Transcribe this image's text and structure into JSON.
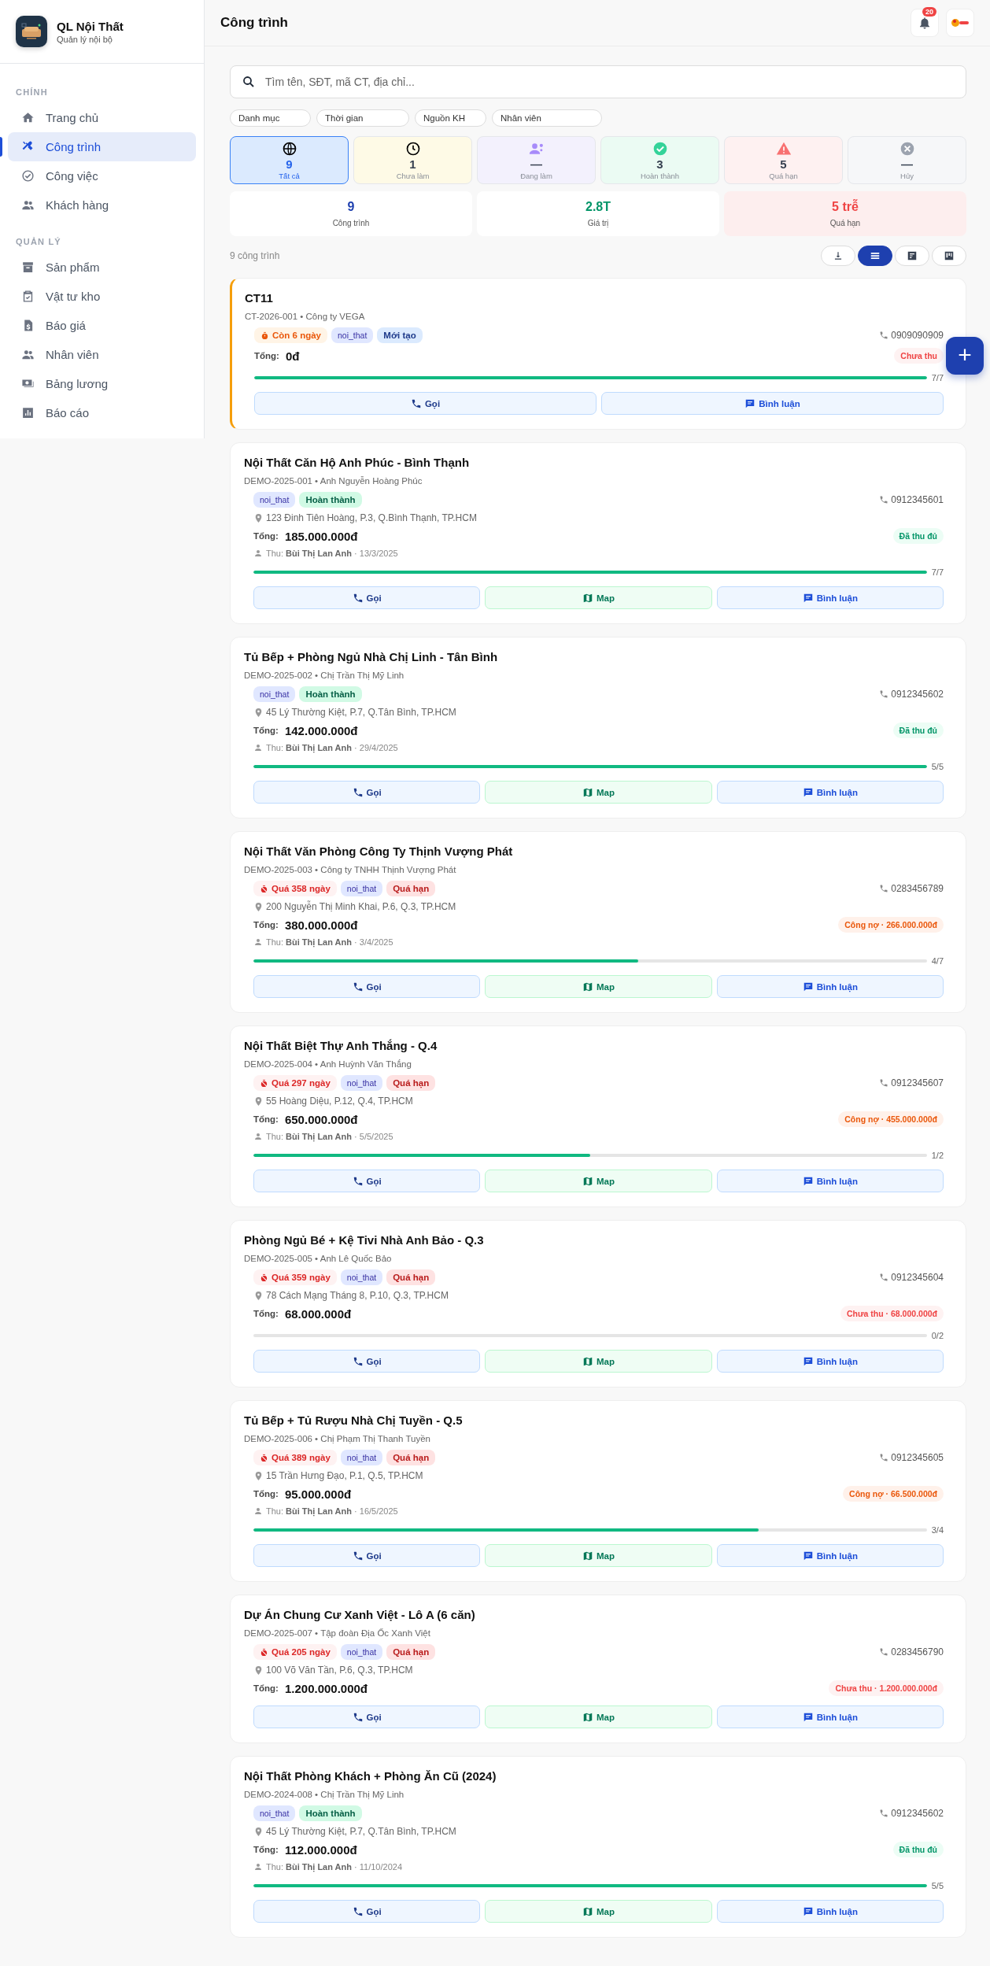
{
  "sidebar": {
    "app_name": "QL Nội Thất",
    "app_subtitle": "Quản lý nội bộ",
    "sections": [
      {
        "title": "CHÍNH",
        "items": [
          {
            "label": "Trang chủ",
            "selected": false
          },
          {
            "label": "Công trình",
            "selected": true
          },
          {
            "label": "Công việc",
            "selected": false
          },
          {
            "label": "Khách hàng",
            "selected": false
          }
        ]
      },
      {
        "title": "QUẢN LÝ",
        "items": [
          {
            "label": "Sản phẩm",
            "selected": false
          },
          {
            "label": "Vật tư kho",
            "selected": false
          },
          {
            "label": "Báo giá",
            "selected": false
          },
          {
            "label": "Nhân viên",
            "selected": false
          },
          {
            "label": "Bảng lương",
            "selected": false
          },
          {
            "label": "Báo cáo",
            "selected": false
          }
        ]
      }
    ]
  },
  "header": {
    "title": "Công trình",
    "notification_count": "20"
  },
  "search": {
    "placeholder": "Tìm tên, SĐT, mã CT, địa chỉ..."
  },
  "filters": [
    "Danh mục",
    "Thời gian",
    "Nguồn KH",
    "Nhân viên"
  ],
  "status_tiles": [
    {
      "kind": "all",
      "count": "9",
      "label": "Tất cả",
      "selected": true
    },
    {
      "kind": "pending",
      "count": "1",
      "label": "Chưa làm",
      "selected": false
    },
    {
      "kind": "active",
      "count": "—",
      "label": "Đang làm",
      "selected": false
    },
    {
      "kind": "done",
      "count": "3",
      "label": "Hoàn thành",
      "selected": false
    },
    {
      "kind": "overdue",
      "count": "5",
      "label": "Quá hạn",
      "selected": false
    },
    {
      "kind": "cancelled",
      "count": "—",
      "label": "Hủy",
      "selected": false
    }
  ],
  "summary": [
    {
      "kind": "count",
      "value": "9",
      "label": "Công trình"
    },
    {
      "kind": "value",
      "value": "2.8T",
      "label": "Giá trị"
    },
    {
      "kind": "late",
      "value": "5 trễ",
      "label": "Quá hạn"
    }
  ],
  "result_count": "9 công trình",
  "view_buttons": [
    {
      "kind": "download",
      "selected": false
    },
    {
      "kind": "list",
      "selected": true
    },
    {
      "kind": "chart",
      "selected": false
    },
    {
      "kind": "board",
      "selected": false
    }
  ],
  "cards": [
    {
      "title": "CT11",
      "meta": "CT-2026-001 • Công ty VEGA",
      "highlighted": true,
      "tags": [
        {
          "kind": "soon",
          "text": "Còn 6 ngày"
        },
        {
          "kind": "category",
          "text": "noi_that"
        },
        {
          "kind": "new",
          "text": "Mới tạo"
        }
      ],
      "phone": "0909090909",
      "total_label": "Tổng:",
      "total": "0đ",
      "payment": {
        "kind": "unpaid",
        "text": "Chưa thu"
      },
      "progress": {
        "level": 1,
        "text": "7/7"
      },
      "buttons": [
        {
          "kind": "call",
          "label": "Gọi"
        },
        {
          "kind": "comment",
          "label": "Bình luận"
        }
      ]
    },
    {
      "title": "Nội Thất Căn Hộ Anh Phúc - Bình Thạnh",
      "meta": "DEMO-2025-001 • Anh Nguyễn Hoàng Phúc",
      "highlighted": false,
      "tags": [
        {
          "kind": "category",
          "text": "noi_that"
        },
        {
          "kind": "done",
          "text": "Hoàn thành"
        }
      ],
      "phone": "0912345601",
      "address": "123 Đinh Tiên Hoàng, P.3, Q.Bình Thạnh, TP.HCM",
      "total_label": "Tổng:",
      "total": "185.000.000đ",
      "payment": {
        "kind": "paid",
        "text": "Đã thu đủ"
      },
      "collector": {
        "label": "Thu:",
        "name": "Bùi Thị Lan Anh",
        "date": "· 13/3/2025"
      },
      "progress": {
        "level": 1,
        "text": "7/7"
      },
      "buttons": [
        {
          "kind": "call",
          "label": "Gọi"
        },
        {
          "kind": "map",
          "label": "Map"
        },
        {
          "kind": "comment",
          "label": "Bình luận"
        }
      ]
    },
    {
      "title": "Tủ Bếp + Phòng Ngủ Nhà Chị Linh - Tân Bình",
      "meta": "DEMO-2025-002 • Chị Trần Thị Mỹ Linh",
      "highlighted": false,
      "tags": [
        {
          "kind": "category",
          "text": "noi_that"
        },
        {
          "kind": "done",
          "text": "Hoàn thành"
        }
      ],
      "phone": "0912345602",
      "address": "45 Lý Thường Kiệt, P.7, Q.Tân Bình, TP.HCM",
      "total_label": "Tổng:",
      "total": "142.000.000đ",
      "payment": {
        "kind": "paid",
        "text": "Đã thu đủ"
      },
      "collector": {
        "label": "Thu:",
        "name": "Bùi Thị Lan Anh",
        "date": "· 29/4/2025"
      },
      "progress": {
        "level": 1,
        "text": "5/5"
      },
      "buttons": [
        {
          "kind": "call",
          "label": "Gọi"
        },
        {
          "kind": "map",
          "label": "Map"
        },
        {
          "kind": "comment",
          "label": "Bình luận"
        }
      ]
    },
    {
      "title": "Nội Thất Văn Phòng Công Ty Thịnh Vượng Phát",
      "meta": "DEMO-2025-003 • Công ty TNHH Thịnh Vượng Phát",
      "highlighted": false,
      "tags": [
        {
          "kind": "late",
          "text": "Quá 358 ngày"
        },
        {
          "kind": "category",
          "text": "noi_that"
        },
        {
          "kind": "overdue",
          "text": "Quá hạn"
        }
      ],
      "phone": "0283456789",
      "address": "200 Nguyễn Thị Minh Khai, P.6, Q.3, TP.HCM",
      "total_label": "Tổng:",
      "total": "380.000.000đ",
      "payment": {
        "kind": "debt",
        "text": "Công nợ · 266.000.000đ"
      },
      "collector": {
        "label": "Thu:",
        "name": "Bùi Thị Lan Anh",
        "date": "· 3/4/2025"
      },
      "progress": {
        "level": 0.571,
        "text": "4/7"
      },
      "buttons": [
        {
          "kind": "call",
          "label": "Gọi"
        },
        {
          "kind": "map",
          "label": "Map"
        },
        {
          "kind": "comment",
          "label": "Bình luận"
        }
      ]
    },
    {
      "title": "Nội Thất Biệt Thự Anh Thắng - Q.4",
      "meta": "DEMO-2025-004 • Anh Huỳnh Văn Thắng",
      "highlighted": false,
      "tags": [
        {
          "kind": "late",
          "text": "Quá 297 ngày"
        },
        {
          "kind": "category",
          "text": "noi_that"
        },
        {
          "kind": "overdue",
          "text": "Quá hạn"
        }
      ],
      "phone": "0912345607",
      "address": "55 Hoàng Diệu, P.12, Q.4, TP.HCM",
      "total_label": "Tổng:",
      "total": "650.000.000đ",
      "payment": {
        "kind": "debt",
        "text": "Công nợ · 455.000.000đ"
      },
      "collector": {
        "label": "Thu:",
        "name": "Bùi Thị Lan Anh",
        "date": "· 5/5/2025"
      },
      "progress": {
        "level": 0.5,
        "text": "1/2"
      },
      "buttons": [
        {
          "kind": "call",
          "label": "Gọi"
        },
        {
          "kind": "map",
          "label": "Map"
        },
        {
          "kind": "comment",
          "label": "Bình luận"
        }
      ]
    },
    {
      "title": "Phòng Ngủ Bé + Kệ Tivi Nhà Anh Bảo - Q.3",
      "meta": "DEMO-2025-005 • Anh Lê Quốc Bảo",
      "highlighted": false,
      "tags": [
        {
          "kind": "late",
          "text": "Quá 359 ngày"
        },
        {
          "kind": "category",
          "text": "noi_that"
        },
        {
          "kind": "overdue",
          "text": "Quá hạn"
        }
      ],
      "phone": "0912345604",
      "address": "78 Cách Mạng Tháng 8, P.10, Q.3, TP.HCM",
      "total_label": "Tổng:",
      "total": "68.000.000đ",
      "payment": {
        "kind": "unpaid",
        "text": "Chưa thu · 68.000.000đ"
      },
      "progress": {
        "level": 0,
        "text": "0/2"
      },
      "buttons": [
        {
          "kind": "call",
          "label": "Gọi"
        },
        {
          "kind": "map",
          "label": "Map"
        },
        {
          "kind": "comment",
          "label": "Bình luận"
        }
      ]
    },
    {
      "title": "Tủ Bếp + Tủ Rượu Nhà Chị Tuyền - Q.5",
      "meta": "DEMO-2025-006 • Chị Phạm Thị Thanh Tuyền",
      "highlighted": false,
      "tags": [
        {
          "kind": "late",
          "text": "Quá 389 ngày"
        },
        {
          "kind": "category",
          "text": "noi_that"
        },
        {
          "kind": "overdue",
          "text": "Quá hạn"
        }
      ],
      "phone": "0912345605",
      "address": "15 Trần Hưng Đạo, P.1, Q.5, TP.HCM",
      "total_label": "Tổng:",
      "total": "95.000.000đ",
      "payment": {
        "kind": "debt",
        "text": "Công nợ · 66.500.000đ"
      },
      "collector": {
        "label": "Thu:",
        "name": "Bùi Thị Lan Anh",
        "date": "· 16/5/2025"
      },
      "progress": {
        "level": 0.75,
        "text": "3/4"
      },
      "buttons": [
        {
          "kind": "call",
          "label": "Gọi"
        },
        {
          "kind": "map",
          "label": "Map"
        },
        {
          "kind": "comment",
          "label": "Bình luận"
        }
      ]
    },
    {
      "title": "Dự Án Chung Cư Xanh Việt - Lô A (6 căn)",
      "meta": "DEMO-2025-007 • Tập đoàn Địa Ốc Xanh Việt",
      "highlighted": false,
      "tags": [
        {
          "kind": "late",
          "text": "Quá 205 ngày"
        },
        {
          "kind": "category",
          "text": "noi_that"
        },
        {
          "kind": "overdue",
          "text": "Quá hạn"
        }
      ],
      "phone": "0283456790",
      "address": "100 Võ Văn Tần, P.6, Q.3, TP.HCM",
      "total_label": "Tổng:",
      "total": "1.200.000.000đ",
      "payment": {
        "kind": "unpaid",
        "text": "Chưa thu · 1.200.000.000đ"
      },
      "buttons": [
        {
          "kind": "call",
          "label": "Gọi"
        },
        {
          "kind": "map",
          "label": "Map"
        },
        {
          "kind": "comment",
          "label": "Bình luận"
        }
      ]
    },
    {
      "title": "Nội Thất Phòng Khách + Phòng Ăn Cũ (2024)",
      "meta": "DEMO-2024-008 • Chị Trần Thị Mỹ Linh",
      "highlighted": false,
      "tags": [
        {
          "kind": "category",
          "text": "noi_that"
        },
        {
          "kind": "done",
          "text": "Hoàn thành"
        }
      ],
      "phone": "0912345602",
      "address": "45 Lý Thường Kiệt, P.7, Q.Tân Bình, TP.HCM",
      "total_label": "Tổng:",
      "total": "112.000.000đ",
      "payment": {
        "kind": "paid",
        "text": "Đã thu đủ"
      },
      "collector": {
        "label": "Thu:",
        "name": "Bùi Thị Lan Anh",
        "date": "· 11/10/2024"
      },
      "progress": {
        "level": 1,
        "text": "5/5"
      },
      "buttons": [
        {
          "kind": "call",
          "label": "Gọi"
        },
        {
          "kind": "map",
          "label": "Map"
        },
        {
          "kind": "comment",
          "label": "Bình luận"
        }
      ]
    }
  ],
  "fab": {
    "label": "+"
  }
}
